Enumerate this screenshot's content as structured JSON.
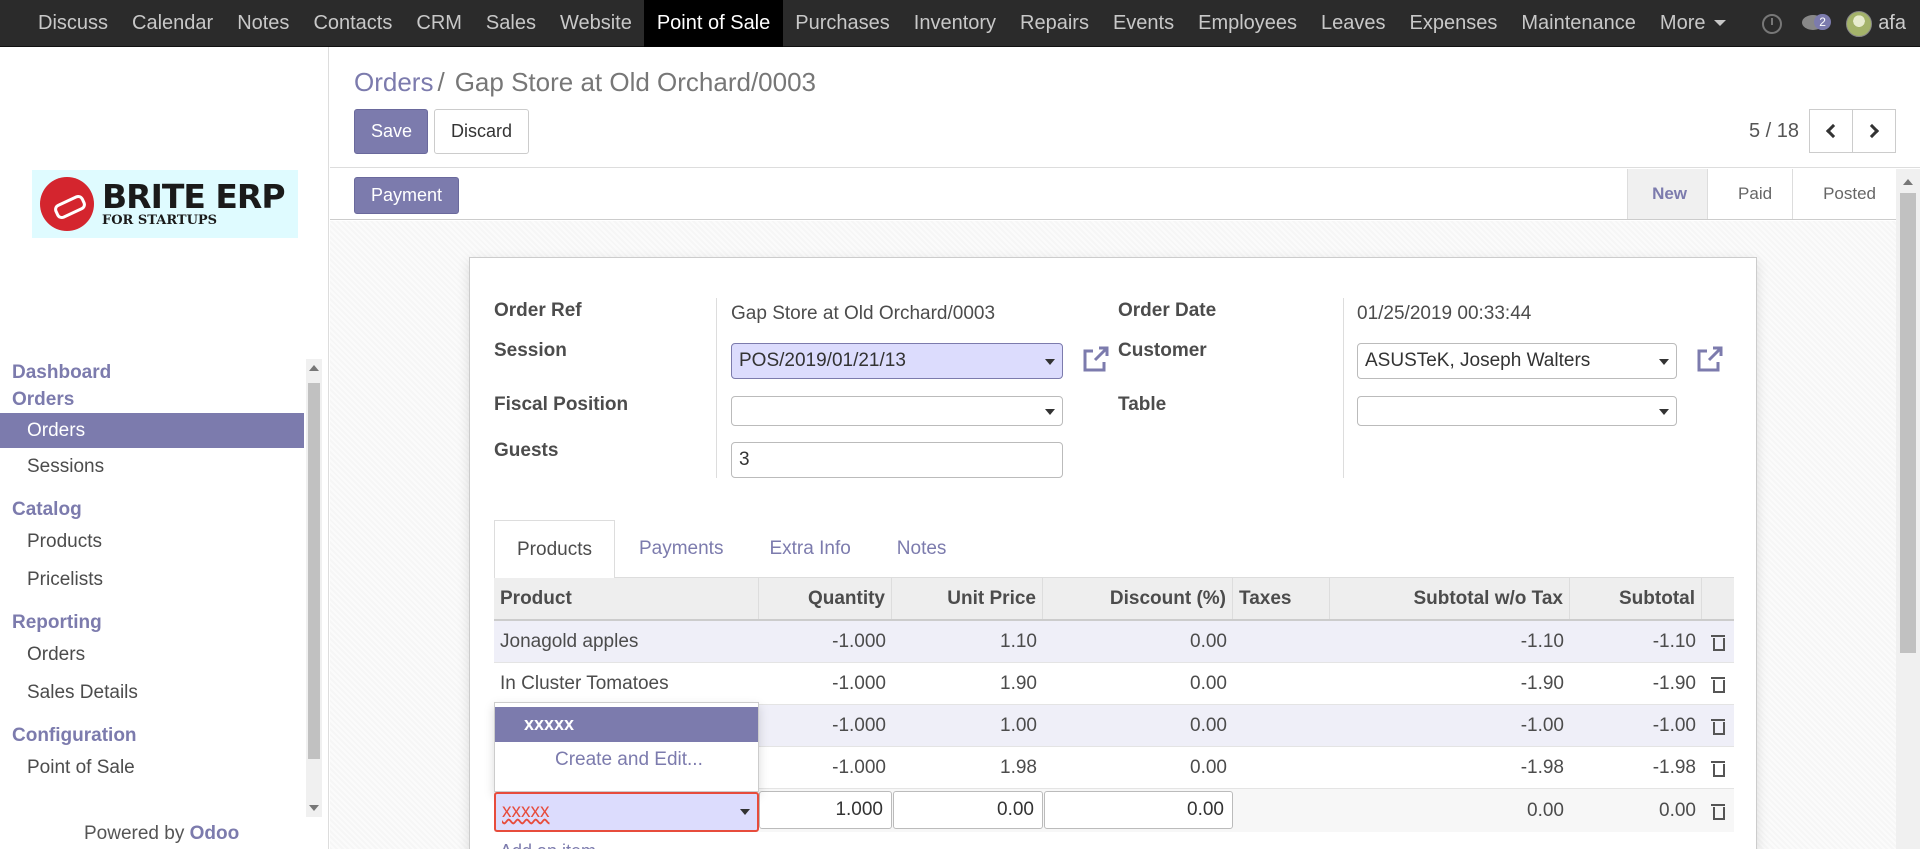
{
  "topbar": {
    "menu": [
      "Discuss",
      "Calendar",
      "Notes",
      "Contacts",
      "CRM",
      "Sales",
      "Website",
      "Point of Sale",
      "Purchases",
      "Inventory",
      "Repairs",
      "Events",
      "Employees",
      "Leaves",
      "Expenses",
      "Maintenance",
      "More"
    ],
    "active_menu": "Point of Sale",
    "chat_count": "2",
    "user_name": "afa"
  },
  "sidebar": {
    "logo_brand": "BRITE ERP",
    "logo_sub": "FOR STARTUPS",
    "sections": [
      {
        "title": "Dashboard"
      },
      {
        "title": "Orders",
        "items": [
          "Orders",
          "Sessions"
        ]
      },
      {
        "title": "Catalog",
        "items": [
          "Products",
          "Pricelists"
        ]
      },
      {
        "title": "Reporting",
        "items": [
          "Orders",
          "Sales Details"
        ]
      },
      {
        "title": "Configuration",
        "items": [
          "Point of Sale"
        ]
      }
    ],
    "active_item": "Orders",
    "powered_by": "Powered by",
    "powered_brand": "Odoo"
  },
  "control": {
    "breadcrumb_parent": "Orders",
    "breadcrumb_current": "Gap Store at Old Orchard/0003",
    "save_label": "Save",
    "discard_label": "Discard",
    "pager_value": "5 / 18"
  },
  "statusbar": {
    "payment_label": "Payment",
    "steps": [
      "New",
      "Paid",
      "Posted"
    ],
    "current_step": "New"
  },
  "form": {
    "order_ref_label": "Order Ref",
    "order_ref_value": "Gap Store at Old Orchard/0003",
    "session_label": "Session",
    "session_value": "POS/2019/01/21/13",
    "fiscal_label": "Fiscal Position",
    "fiscal_value": "",
    "guests_label": "Guests",
    "guests_value": "3",
    "order_date_label": "Order Date",
    "order_date_value": "01/25/2019 00:33:44",
    "customer_label": "Customer",
    "customer_value": "ASUSTeK, Joseph Walters",
    "table_label": "Table",
    "table_value": ""
  },
  "tabs": [
    "Products",
    "Payments",
    "Extra Info",
    "Notes"
  ],
  "active_tab": "Products",
  "lines": {
    "headers": [
      "Product",
      "Quantity",
      "Unit Price",
      "Discount (%)",
      "Taxes",
      "Subtotal w/o Tax",
      "Subtotal"
    ],
    "rows": [
      {
        "product": "Jonagold apples",
        "qty": "-1.000",
        "price": "1.10",
        "disc": "0.00",
        "taxes": "",
        "sub": "-1.10",
        "total": "-1.10"
      },
      {
        "product": "In Cluster Tomatoes",
        "qty": "-1.000",
        "price": "1.90",
        "disc": "0.00",
        "taxes": "",
        "sub": "-1.90",
        "total": "-1.90"
      },
      {
        "product": "",
        "qty": "-1.000",
        "price": "1.00",
        "disc": "0.00",
        "taxes": "",
        "sub": "-1.00",
        "total": "-1.00"
      },
      {
        "product": "",
        "qty": "-1.000",
        "price": "1.98",
        "disc": "0.00",
        "taxes": "",
        "sub": "-1.98",
        "total": "-1.98"
      }
    ],
    "edit_row": {
      "product": "xxxxx",
      "qty": "1.000",
      "price": "0.00",
      "disc": "0.00",
      "sub": "0.00",
      "total": "0.00"
    },
    "autocomplete": {
      "suggestion": "xxxxx",
      "create_label": "Create and Edit..."
    },
    "add_item_label": "Add an item"
  }
}
